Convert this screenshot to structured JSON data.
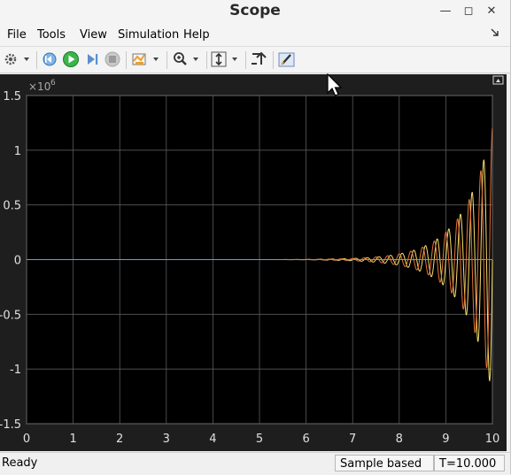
{
  "window": {
    "title": "Scope"
  },
  "window_controls": {
    "minimize": "—",
    "maximize": "◻",
    "close": "✕"
  },
  "menu": {
    "file": "File",
    "tools": "Tools",
    "view": "View",
    "simulation": "Simulation",
    "help": "Help"
  },
  "toolbar": {
    "icons": [
      "settings-icon",
      "step-back-icon",
      "run-icon",
      "step-forward-icon",
      "stop-icon",
      "highlight-signal-icon",
      "zoom-icon",
      "scale-axes-icon",
      "restore-icon",
      "measurements-icon"
    ]
  },
  "chart_data": {
    "type": "line",
    "title": "",
    "xlabel": "",
    "ylabel": "",
    "y_exponent_label": "×10",
    "y_exponent_power": "6",
    "xlim": [
      0,
      10
    ],
    "ylim": [
      -1.5,
      1.5
    ],
    "x_ticks": [
      "0",
      "1",
      "2",
      "3",
      "4",
      "5",
      "6",
      "7",
      "8",
      "9",
      "10"
    ],
    "y_ticks": [
      "1.5",
      "1",
      "0.5",
      "0",
      "-0.5",
      "-1",
      "-1.5"
    ],
    "grid": true,
    "background": "#000000",
    "series": [
      {
        "color": "#f5e06a",
        "envelope": {
          "t_start": 6.5,
          "t_end": 10,
          "amp_start": 0.005,
          "amp_end": 1.22
        },
        "freq_hz": 4.0,
        "phase": 0.0
      },
      {
        "color": "#e8743a",
        "envelope": {
          "t_start": 6.5,
          "t_end": 10,
          "amp_start": 0.005,
          "amp_end": 1.2
        },
        "freq_hz": 4.0,
        "phase": 1.5708
      },
      {
        "color": "#4aa8e8",
        "constant": 0
      }
    ]
  },
  "status": {
    "ready": "Ready",
    "mode": "Sample based",
    "time": "T=10.000"
  }
}
